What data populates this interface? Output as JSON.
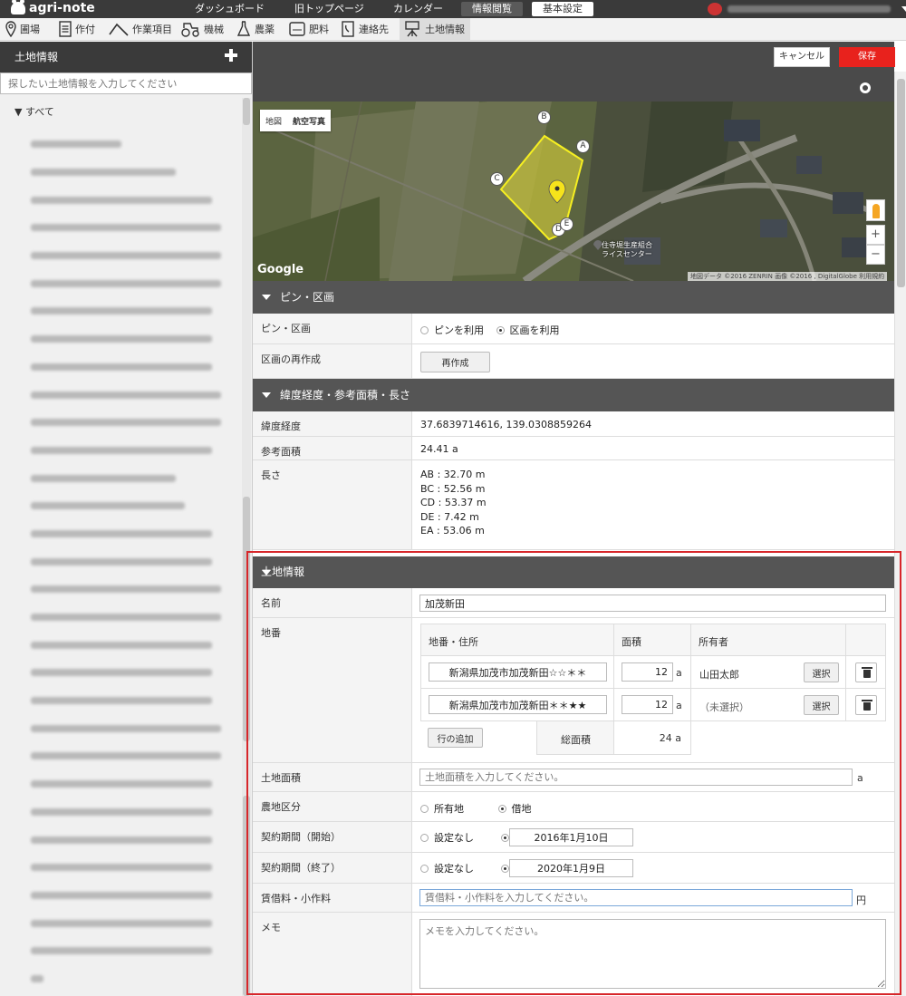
{
  "app": {
    "logo": "agri-note"
  },
  "topnav": {
    "items": [
      "ダッシュボード",
      "旧トップページ",
      "カレンダー",
      "情報閲覧",
      "基本設定"
    ]
  },
  "subnav": {
    "items": [
      "圃場",
      "作付",
      "作業項目",
      "機械",
      "農薬",
      "肥料",
      "連絡先",
      "土地情報"
    ]
  },
  "sidebar": {
    "title": "土地情報",
    "search_placeholder": "探したい土地情報を入力してください",
    "all_label": "▼ すべて"
  },
  "header": {
    "cancel": "キャンセル",
    "save": "保存"
  },
  "map": {
    "type_map": "地図",
    "type_aerial": "航空写真",
    "provider": "Google",
    "copyright": "地図データ ©2016 ZENRIN 画像 ©2016 , DigitalGlobe  利用規約",
    "poi": [
      "住寺堀生産組合",
      "ライスセンター"
    ],
    "vertex_labels": [
      "A",
      "B",
      "C",
      "D",
      "E"
    ],
    "zoom_in": "+",
    "zoom_out": "−"
  },
  "pin_section": {
    "title": "ピン・区画",
    "pin_mode_label": "ピン・区画",
    "option_pin": "ピンを利用",
    "option_area": "区画を利用",
    "selected": "区画を利用",
    "recreate_label": "区画の再作成",
    "recreate_button": "再作成"
  },
  "geo_section": {
    "title": "緯度経度・参考面積・長さ",
    "latlng_label": "緯度経度",
    "latlng": "37.6839714616, 139.0308859264",
    "area_label": "参考面積",
    "area": "24.41 a",
    "length_label": "長さ",
    "lengths": [
      "AB : 32.70 m",
      "BC : 52.56 m",
      "CD : 53.37 m",
      "DE : 7.42 m",
      "EA : 53.06 m"
    ]
  },
  "land": {
    "title": "土地情報",
    "name_label": "名前",
    "name_value": "加茂新田",
    "lot_label": "地番",
    "lot_columns": [
      "地番・住所",
      "面積",
      "所有者"
    ],
    "lots": [
      {
        "address": "新潟県加茂市加茂新田☆☆＊＊",
        "area": "12",
        "unit": "a",
        "owner": "山田太郎",
        "select": "選択"
      },
      {
        "address": "新潟県加茂市加茂新田＊＊★★",
        "area": "12",
        "unit": "a",
        "owner": "（未選択）",
        "select": "選択"
      }
    ],
    "add_row": "行の追加",
    "total_label": "総面積",
    "total_value": "24 a",
    "land_area_label": "土地面積",
    "land_area_placeholder": "土地面積を入力してください。",
    "land_area_unit": "a",
    "category_label": "農地区分",
    "category_options": [
      "所有地",
      "借地"
    ],
    "category_selected": "借地",
    "contract_start_label": "契約期間（開始）",
    "contract_end_label": "契約期間（終了）",
    "none_option": "設定なし",
    "contract_start": "2016年1月10日",
    "contract_end": "2020年1月9日",
    "rent_label": "賃借料・小作料",
    "rent_placeholder": "賃借料・小作料を入力してください。",
    "rent_unit": "円",
    "memo_label": "メモ",
    "memo_placeholder": "メモを入力してください。"
  },
  "colors": {
    "save": "#e8221d",
    "highlight": "#d7262a",
    "header": "#3a3a3a",
    "section": "#555555"
  }
}
